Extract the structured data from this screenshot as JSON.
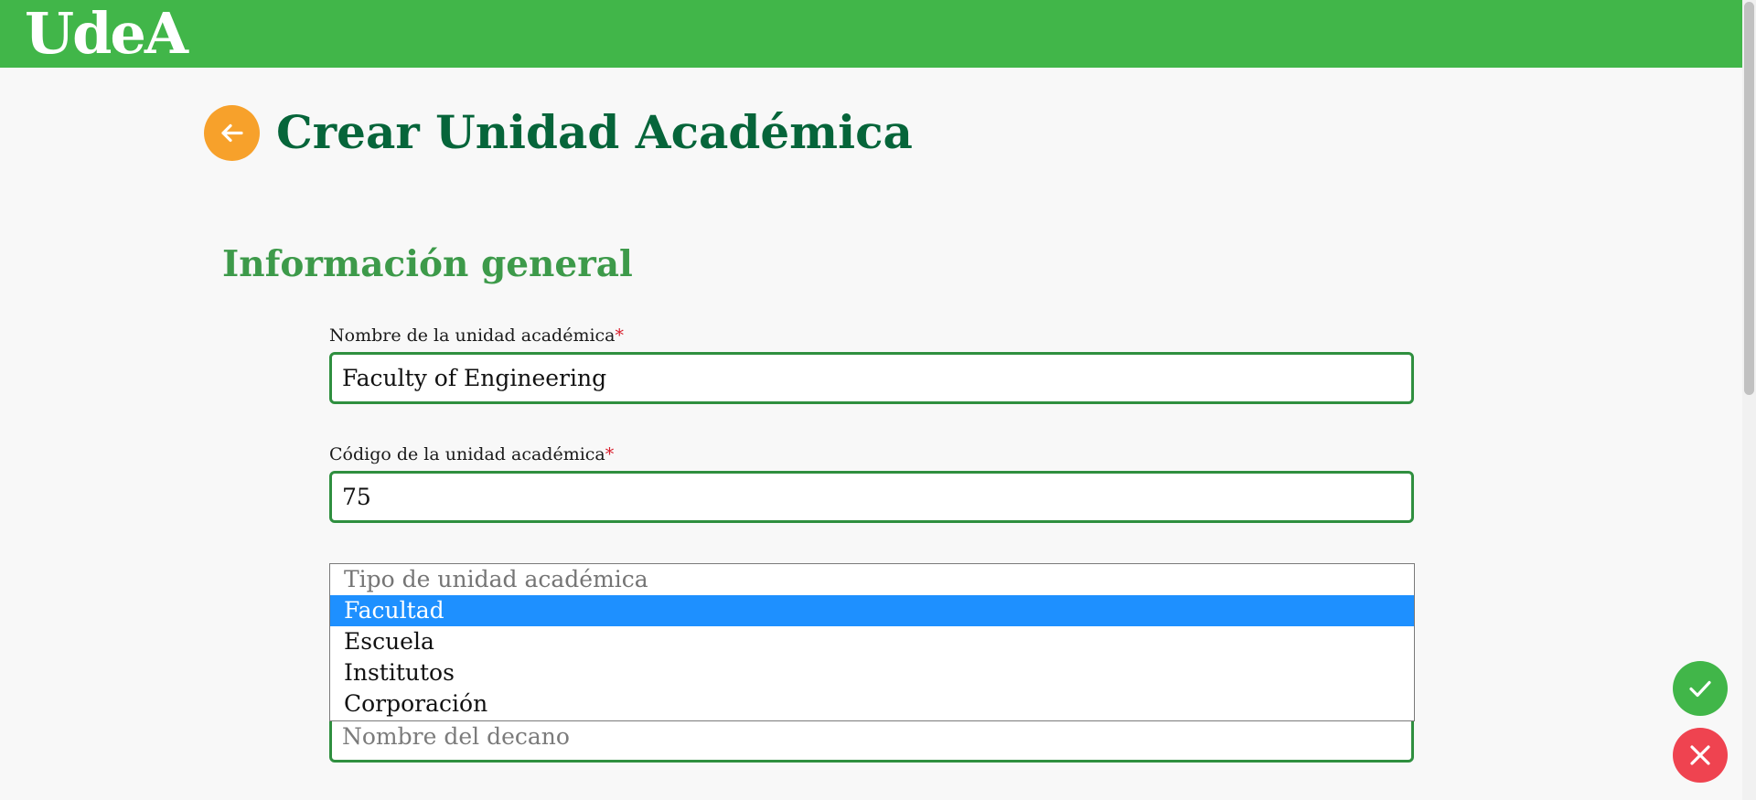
{
  "header": {
    "logo": "UdeA",
    "color": "#41b649"
  },
  "page": {
    "title": "Crear Unidad Académica",
    "back_icon": "arrow-left-icon",
    "section_title": "Información general"
  },
  "form": {
    "nombre": {
      "label": "Nombre de la unidad académica",
      "required_mark": "*",
      "value": "Faculty of Engineering"
    },
    "codigo": {
      "label": "Código de la unidad académica",
      "required_mark": "*",
      "value": "75"
    },
    "tipo": {
      "placeholder": "Tipo de unidad académica",
      "options": [
        "Facultad",
        "Escuela",
        "Institutos",
        "Corporación"
      ],
      "highlighted": "Facultad"
    },
    "decano": {
      "placeholder": "Nombre del decano",
      "value": ""
    }
  },
  "actions": {
    "confirm_icon": "check-icon",
    "cancel_icon": "close-icon",
    "confirm_color": "#41b649",
    "cancel_color": "#ef4350"
  }
}
